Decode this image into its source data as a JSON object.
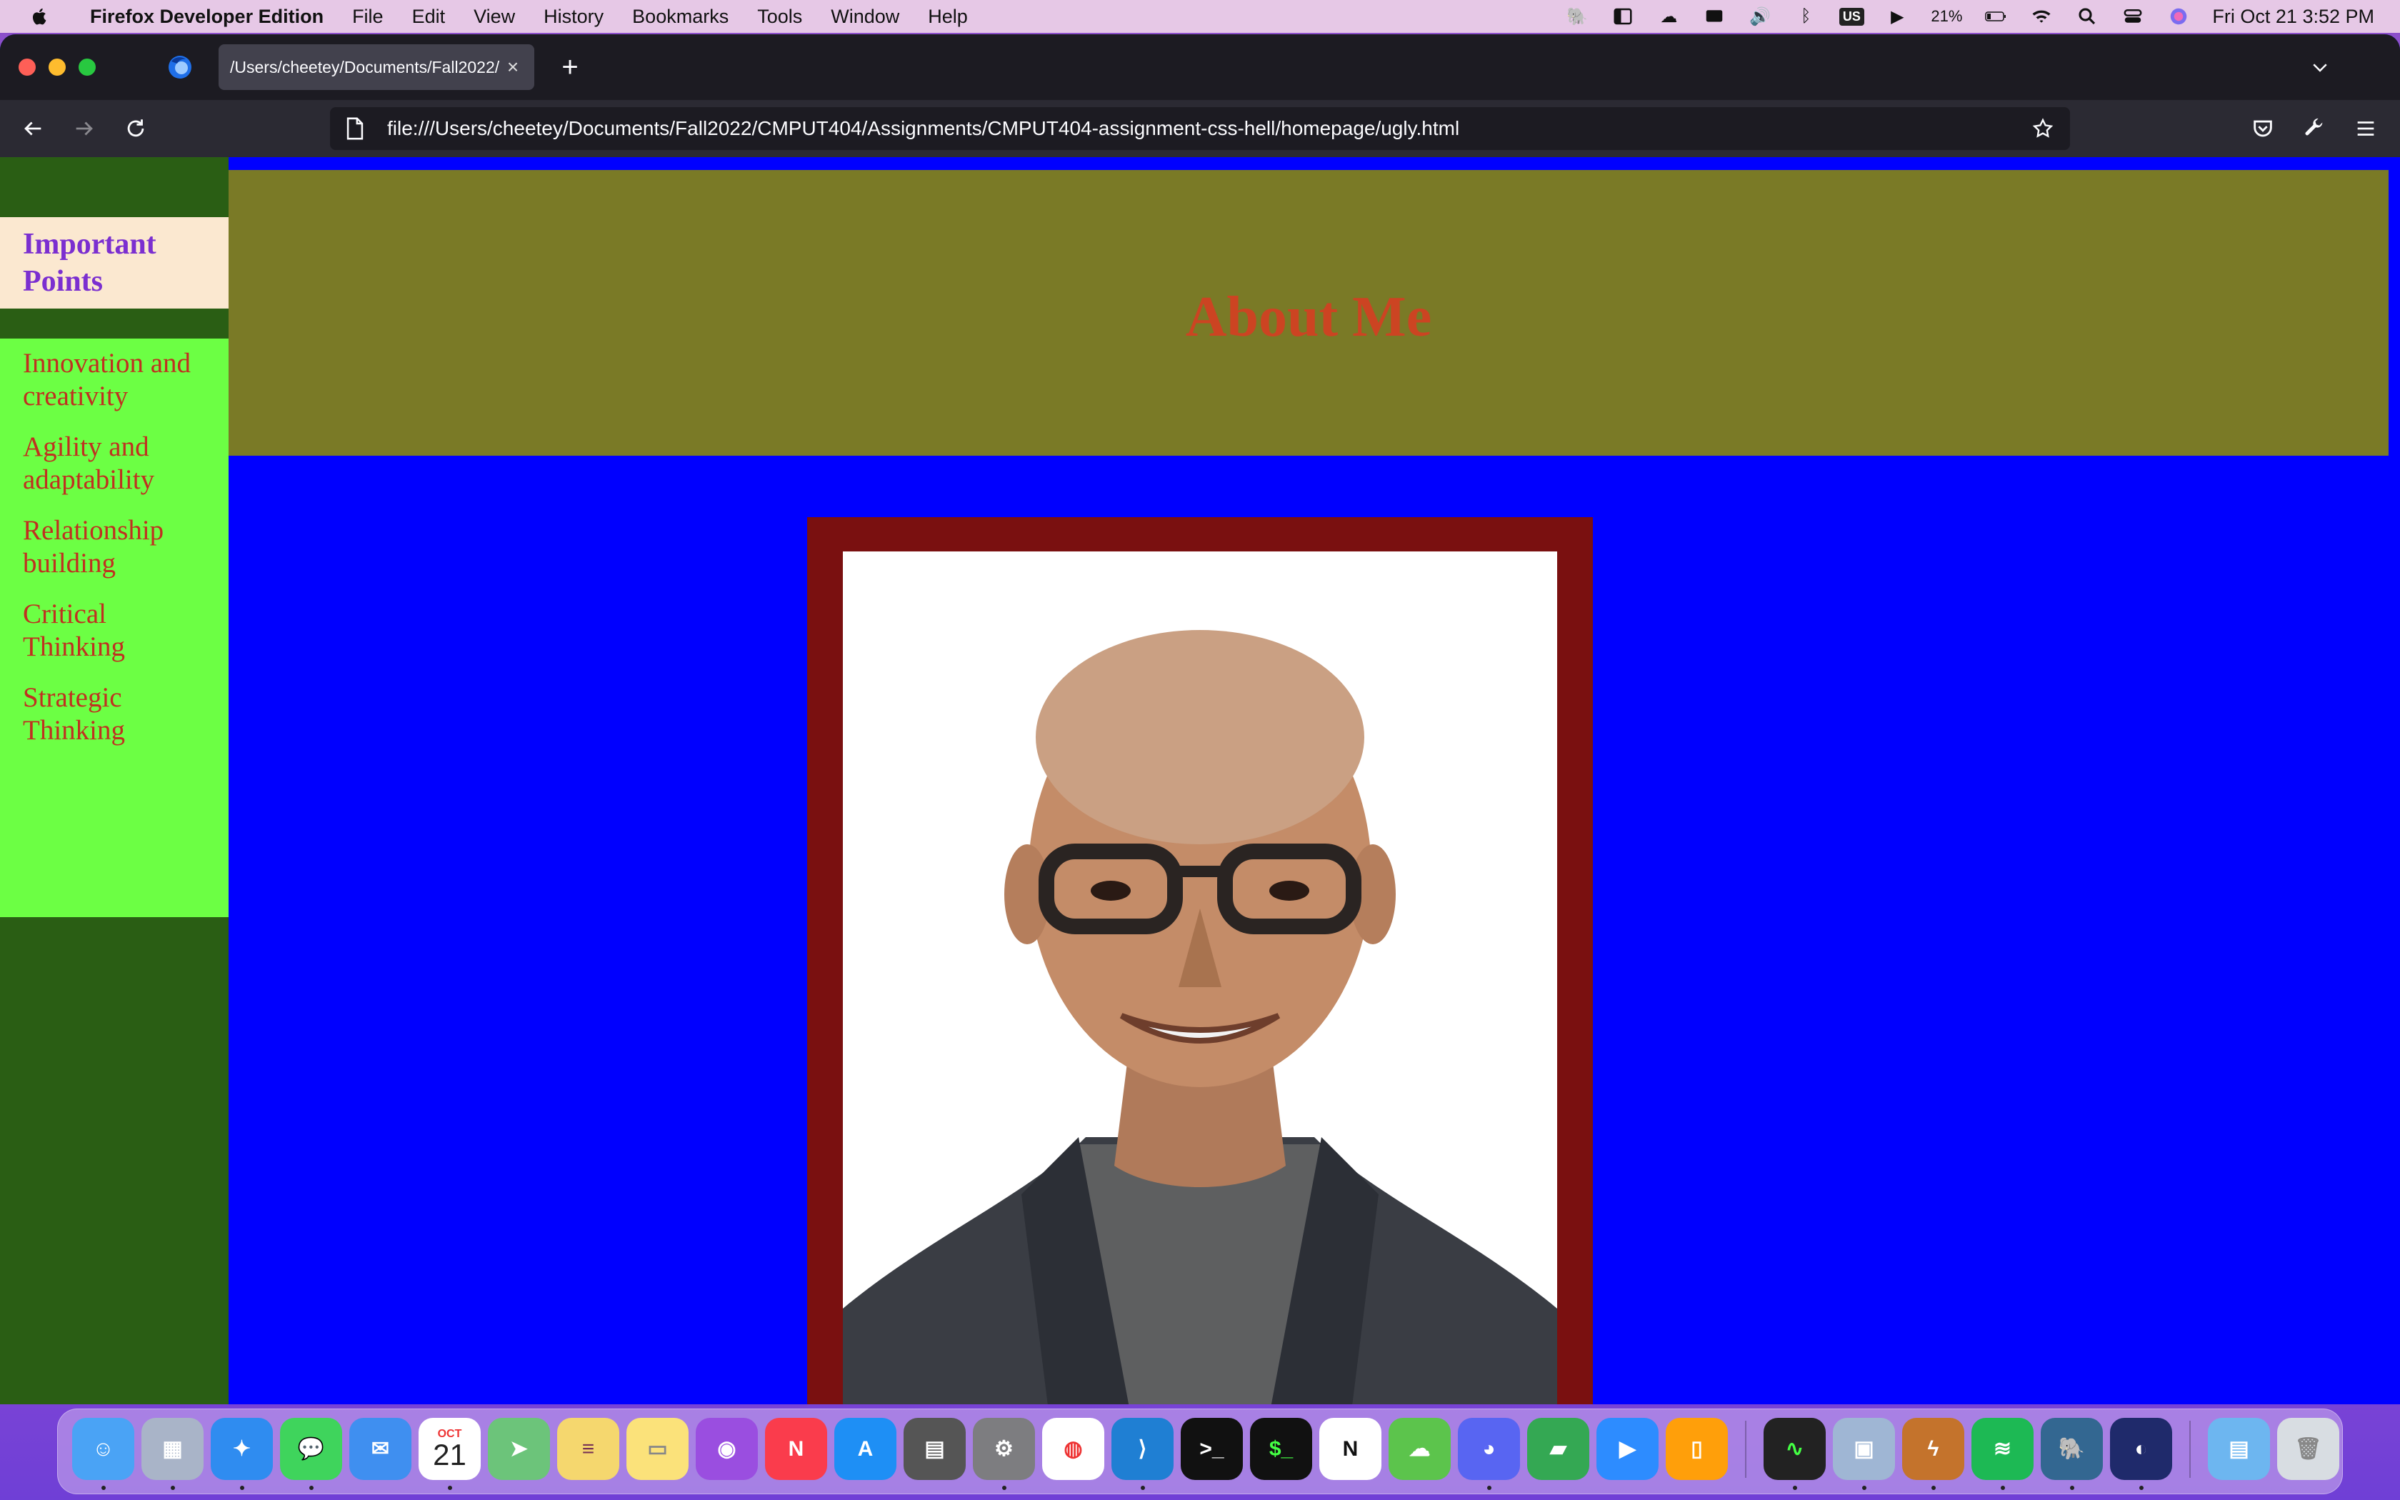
{
  "menubar": {
    "app_name": "Firefox Developer Edition",
    "menus": [
      "File",
      "Edit",
      "View",
      "History",
      "Bookmarks",
      "Tools",
      "Window",
      "Help"
    ],
    "battery": "21%",
    "input_source": "US",
    "clock": "Fri Oct 21  3:52 PM"
  },
  "browser": {
    "tab_title": "/Users/cheetey/Documents/Fall2022/",
    "url": "file:///Users/cheetey/Documents/Fall2022/CMPUT404/Assignments/CMPUT404-assignment-css-hell/homepage/ugly.html"
  },
  "page": {
    "sidebar_title": "Important Points",
    "sidebar_items": [
      "Innovation and creativity",
      "Agility and adaptability",
      "Relationship building",
      "Critical Thinking",
      "Strategic Thinking"
    ],
    "heading": "About Me"
  },
  "dock": {
    "calendar_month": "OCT",
    "calendar_day": "21",
    "apps": [
      "finder-icon",
      "launchpad-icon",
      "safari-icon",
      "messages-icon",
      "mail-icon",
      "calendar-icon",
      "maps-icon",
      "stickies-icon",
      "notes-icon",
      "podcasts-icon",
      "news-icon",
      "app-store-icon",
      "calculator-icon",
      "system-preferences-icon",
      "chrome-icon",
      "vscode-icon",
      "terminal-icon",
      "iterm-icon",
      "notion-icon",
      "cloud-app-icon",
      "discord-icon",
      "chat-app-icon",
      "zoom-icon",
      "books-icon",
      "activity-monitor-icon",
      "preview-icon",
      "reeder-icon",
      "spotify-icon",
      "postgres-icon",
      "firefox-dev-icon",
      "downloads-folder-icon",
      "trash-icon"
    ]
  },
  "colors": {
    "page_background": "#0000ff",
    "sidebar_background": "#2a5e14",
    "sidebar_title_background": "#fbe8d0",
    "sidebar_title_text": "#7b2fd0",
    "sidebar_list_background": "#6cff44",
    "sidebar_list_text": "#c03020",
    "banner_background": "#7a7a26",
    "heading_text": "#cc4422",
    "photo_frame": "#7a1010"
  }
}
